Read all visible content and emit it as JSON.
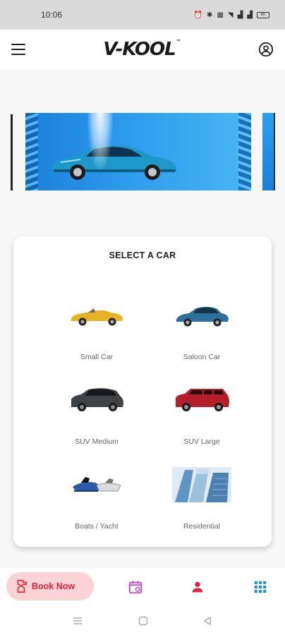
{
  "status_bar": {
    "time": "10:06",
    "indicators": [
      "alarm-icon",
      "bluetooth-icon",
      "volte-icon",
      "wifi-icon",
      "signal-icon",
      "signal-icon",
      "battery-icon"
    ],
    "battery_level": "80"
  },
  "header": {
    "logo_text": "V-KOOL",
    "logo_mark": "™",
    "menu_icon": "menu-icon",
    "account_icon": "account-circle-icon"
  },
  "banner": {
    "image": "car-wash-banner"
  },
  "car_select": {
    "title": "SELECT A CAR",
    "options": [
      {
        "label": "Small Car",
        "icon": "convertible-car-icon",
        "color": "#e6b422"
      },
      {
        "label": "Saloon Car",
        "icon": "sedan-car-icon",
        "color": "#2c6f9a"
      },
      {
        "label": "SUV Medium",
        "icon": "suv-medium-icon",
        "color": "#3d4347"
      },
      {
        "label": "SUV Large",
        "icon": "suv-large-icon",
        "color": "#b3202a"
      },
      {
        "label": "Boats / Yacht",
        "icon": "jetski-icon",
        "color": "#2a5aa8"
      },
      {
        "label": "Residential",
        "icon": "building-icon",
        "color": "#6fa6cf"
      }
    ]
  },
  "bottom_nav": {
    "book_label": "Book Now",
    "book_icon": "spray-bottle-icon",
    "items": [
      "calendar-icon",
      "person-icon",
      "grid-icon"
    ],
    "accent": "#e0243e",
    "calendar_color": "#c043d6",
    "grid_color": "#1f8ae0"
  },
  "system_nav": {
    "buttons": [
      "recents-icon",
      "home-icon",
      "back-icon"
    ]
  }
}
